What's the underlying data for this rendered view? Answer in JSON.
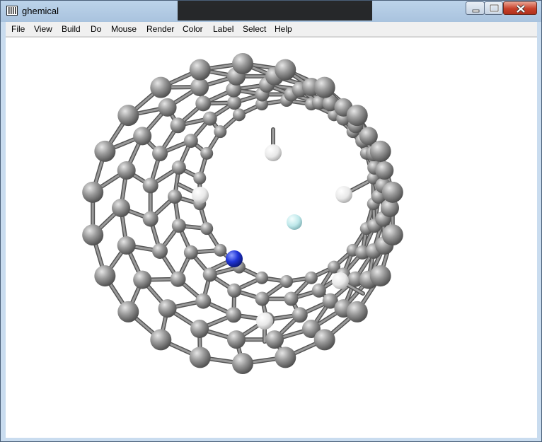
{
  "window": {
    "title": "ghemical",
    "app_icon": "ghemical-app-icon",
    "controls": [
      "minimize-icon",
      "maximize-icon",
      "close-icon"
    ]
  },
  "menubar": {
    "items": [
      {
        "label": "File"
      },
      {
        "label": "View"
      },
      {
        "label": "Build"
      },
      {
        "label": "Do"
      },
      {
        "label": "Mouse"
      },
      {
        "label": "Render"
      },
      {
        "label": "Color"
      },
      {
        "label": "Label"
      },
      {
        "label": "Select"
      },
      {
        "label": "Help"
      }
    ]
  },
  "viewport": {
    "content": "molecular model of a carbon nanotube with hydrogen, nitrogen and a central light-blue atom",
    "colors": {
      "carbon": "#8a8a8a",
      "hydrogen": "#f2f2f2",
      "nitrogen": "#1f35d8",
      "center_atom": "#bfe8ea",
      "bond": "#6e6e6e"
    }
  }
}
